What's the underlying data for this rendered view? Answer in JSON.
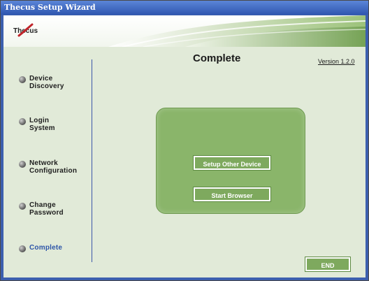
{
  "window": {
    "title": "Thecus Setup Wizard"
  },
  "header": {
    "logo_text": "Thecus"
  },
  "sidebar": {
    "items": [
      {
        "label": "Device\nDiscovery",
        "active": false
      },
      {
        "label": "Login\nSystem",
        "active": false
      },
      {
        "label": "Network\nConfiguration",
        "active": false
      },
      {
        "label": "Change\nPassword",
        "active": false
      },
      {
        "label": "Complete",
        "active": true
      }
    ]
  },
  "main": {
    "title": "Complete",
    "version": "Version 1.2.0",
    "setup_other_label": "Setup Other Device",
    "start_browser_label": "Start Browser",
    "end_label": "END"
  },
  "colors": {
    "background": "#e1ead8",
    "panel": "#8ab56a",
    "button": "#7ea95e",
    "active_step": "#2d55a8",
    "title_bar": "#2f56b0"
  }
}
